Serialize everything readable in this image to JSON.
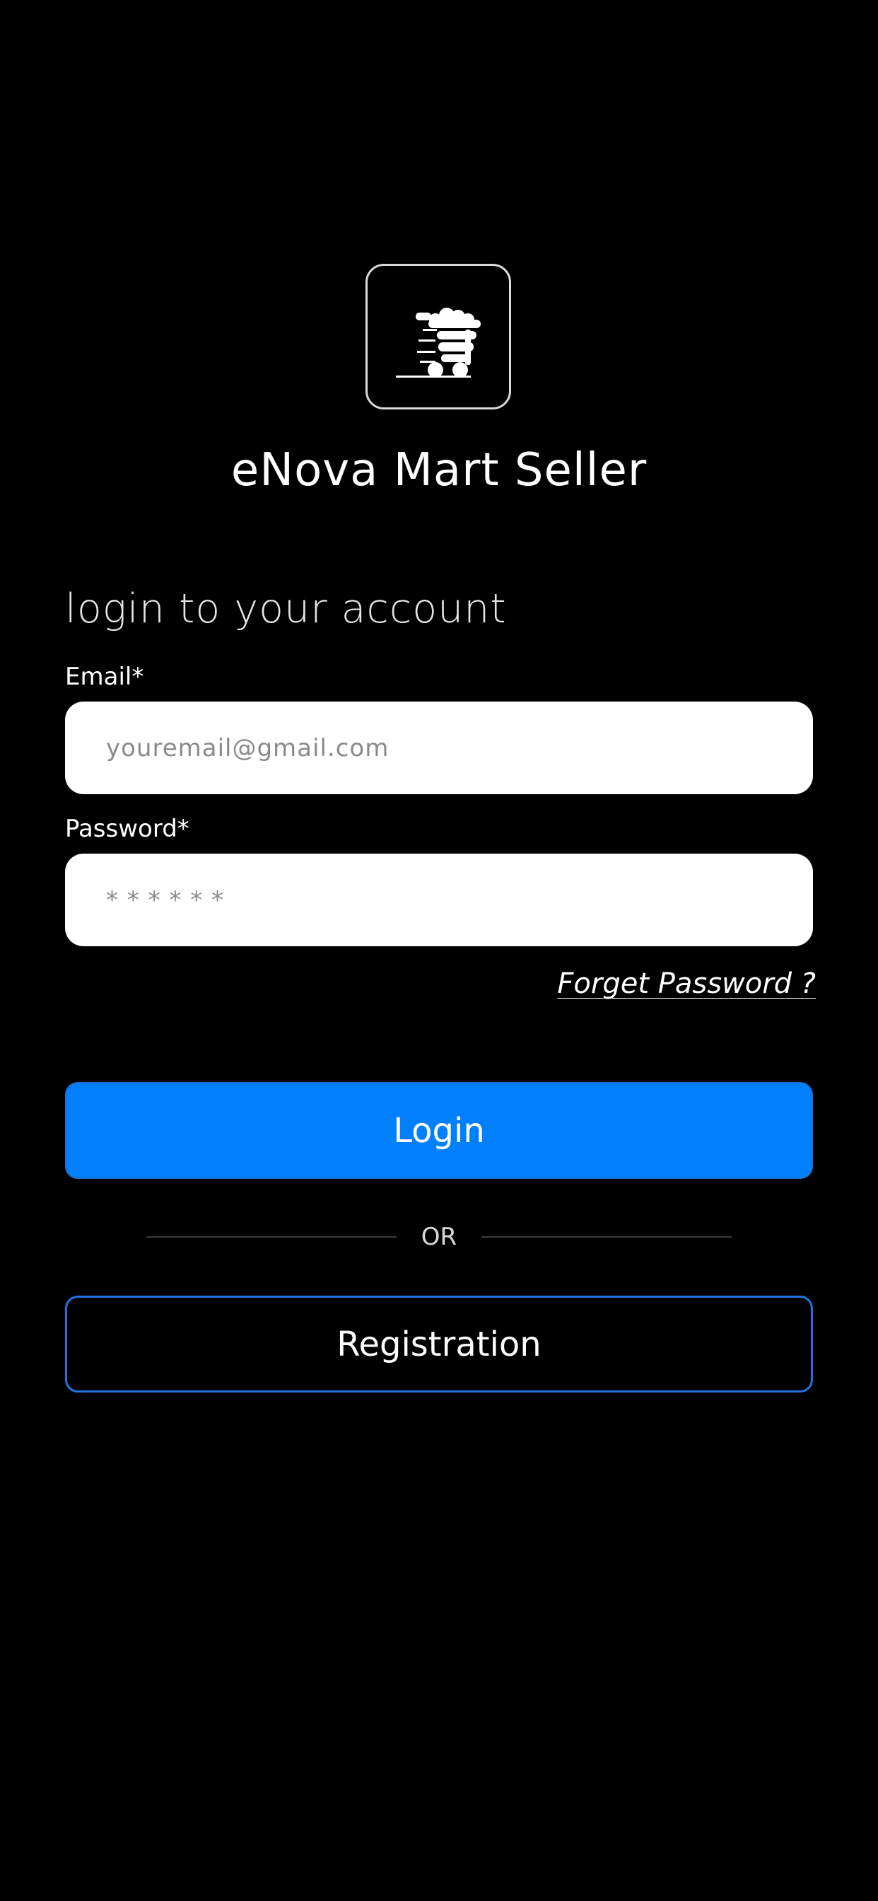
{
  "app": {
    "title": "eNova Mart Seller",
    "logo_icon": "shopping-cart-icon"
  },
  "login_form": {
    "heading": "login to your account",
    "email": {
      "label": "Email*",
      "placeholder": "youremail@gmail.com",
      "value": ""
    },
    "password": {
      "label": "Password*",
      "placeholder": "* * * * * *",
      "value": ""
    },
    "forgot_password": "Forget Password ?",
    "login_label": "Login",
    "divider_text": "OR",
    "registration_label": "Registration"
  },
  "colors": {
    "background": "#000000",
    "primary": "#0080ff",
    "input_background": "#ffffff",
    "outline_border": "#1f74e0"
  }
}
